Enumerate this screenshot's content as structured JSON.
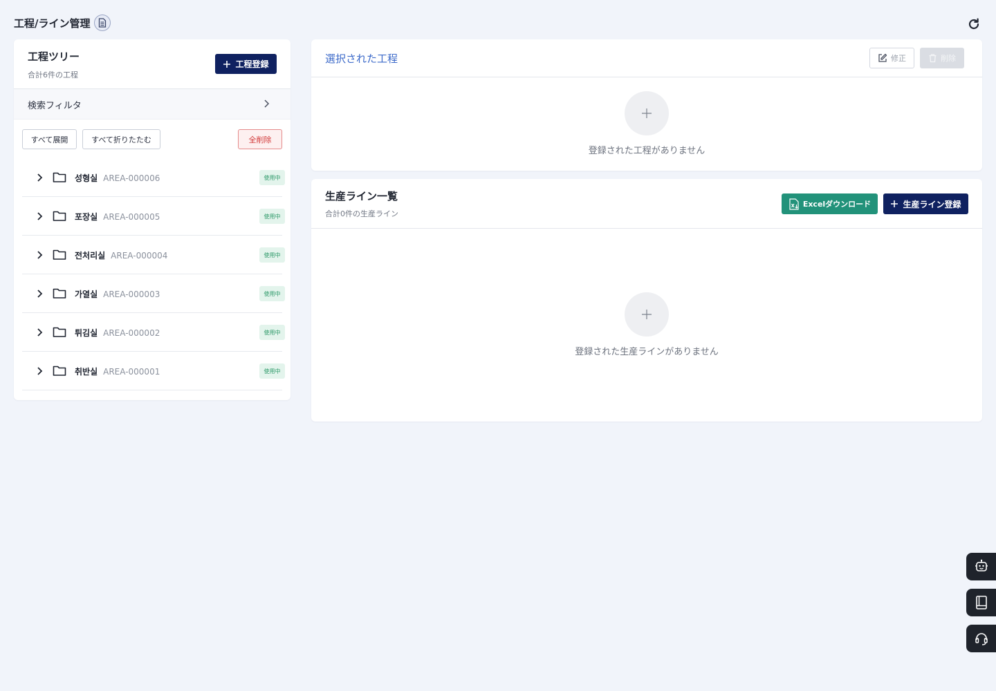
{
  "page": {
    "title": "工程/ライン管理",
    "doc_icon": "document-icon",
    "refresh_icon": "refresh-icon"
  },
  "process_tree": {
    "title": "工程ツリー",
    "subtitle": "合計6件の工程",
    "add_button": "工程登録",
    "filter_label": "検索フィルタ",
    "expand_all": "すべて展開",
    "collapse_all": "すべて折りたたむ",
    "delete_all": "全削除",
    "items": [
      {
        "name": "성형실",
        "code": "AREA-000006",
        "status": "使用中"
      },
      {
        "name": "포장실",
        "code": "AREA-000005",
        "status": "使用中"
      },
      {
        "name": "전처리실",
        "code": "AREA-000004",
        "status": "使用中"
      },
      {
        "name": "가열실",
        "code": "AREA-000003",
        "status": "使用中"
      },
      {
        "name": "튀김실",
        "code": "AREA-000002",
        "status": "使用中"
      },
      {
        "name": "취반실",
        "code": "AREA-000001",
        "status": "使用中"
      }
    ]
  },
  "selected_process": {
    "title": "選択された工程",
    "edit_button": "修正",
    "delete_button": "削除",
    "empty_text": "登録された工程がありません"
  },
  "production_lines": {
    "title": "生産ライン一覧",
    "subtitle": "合計0件の生産ライン",
    "excel_button": "Excelダウンロード",
    "add_button": "生産ライン登録",
    "empty_text": "登録された生産ラインがありません"
  },
  "floating_buttons": [
    "chatbot-icon",
    "manual-book-icon",
    "headset-support-icon"
  ],
  "colors": {
    "primary": "#0f2160",
    "accent_blue": "#3b69c9",
    "excel_green": "#22927a",
    "danger": "#d23838",
    "status_green": "#2f9a6a",
    "background": "#f1f4fa"
  }
}
